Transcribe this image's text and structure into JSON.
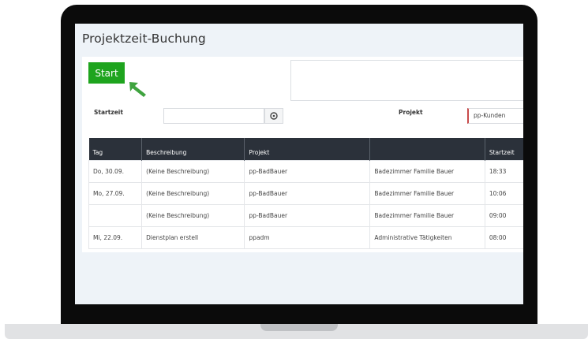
{
  "page": {
    "title": "Projektzeit-Buchung"
  },
  "controls": {
    "start_label": "Start",
    "starttime_label": "Startzeit",
    "starttime_value": "",
    "project_label": "Projekt",
    "project_value": "pp-Kunden"
  },
  "table": {
    "headers": [
      "Tag",
      "Beschreibung",
      "Projekt",
      "",
      "Startzeit"
    ],
    "rows": [
      [
        "Do, 30.09.",
        "(Keine Beschreibung)",
        "pp-BadBauer",
        "Badezimmer Familie Bauer",
        "18:33"
      ],
      [
        "Mo, 27.09.",
        "(Keine Beschreibung)",
        "pp-BadBauer",
        "Badezimmer Familie Bauer",
        "10:06"
      ],
      [
        "",
        "(Keine Beschreibung)",
        "pp-BadBauer",
        "Badezimmer Familie Bauer",
        "09:00"
      ],
      [
        "Mi, 22.09.",
        "Dienstplan erstell",
        "ppadm",
        "Administrative Tätigkeiten",
        "08:00"
      ]
    ]
  },
  "colors": {
    "start_button": "#1ea41e",
    "arrow": "#3fa33f",
    "table_header": "#2b313a",
    "project_marker": "#c84a4a"
  },
  "icons": {
    "arrow": "arrow-up-left-icon",
    "starttime_button": "clock-icon"
  }
}
